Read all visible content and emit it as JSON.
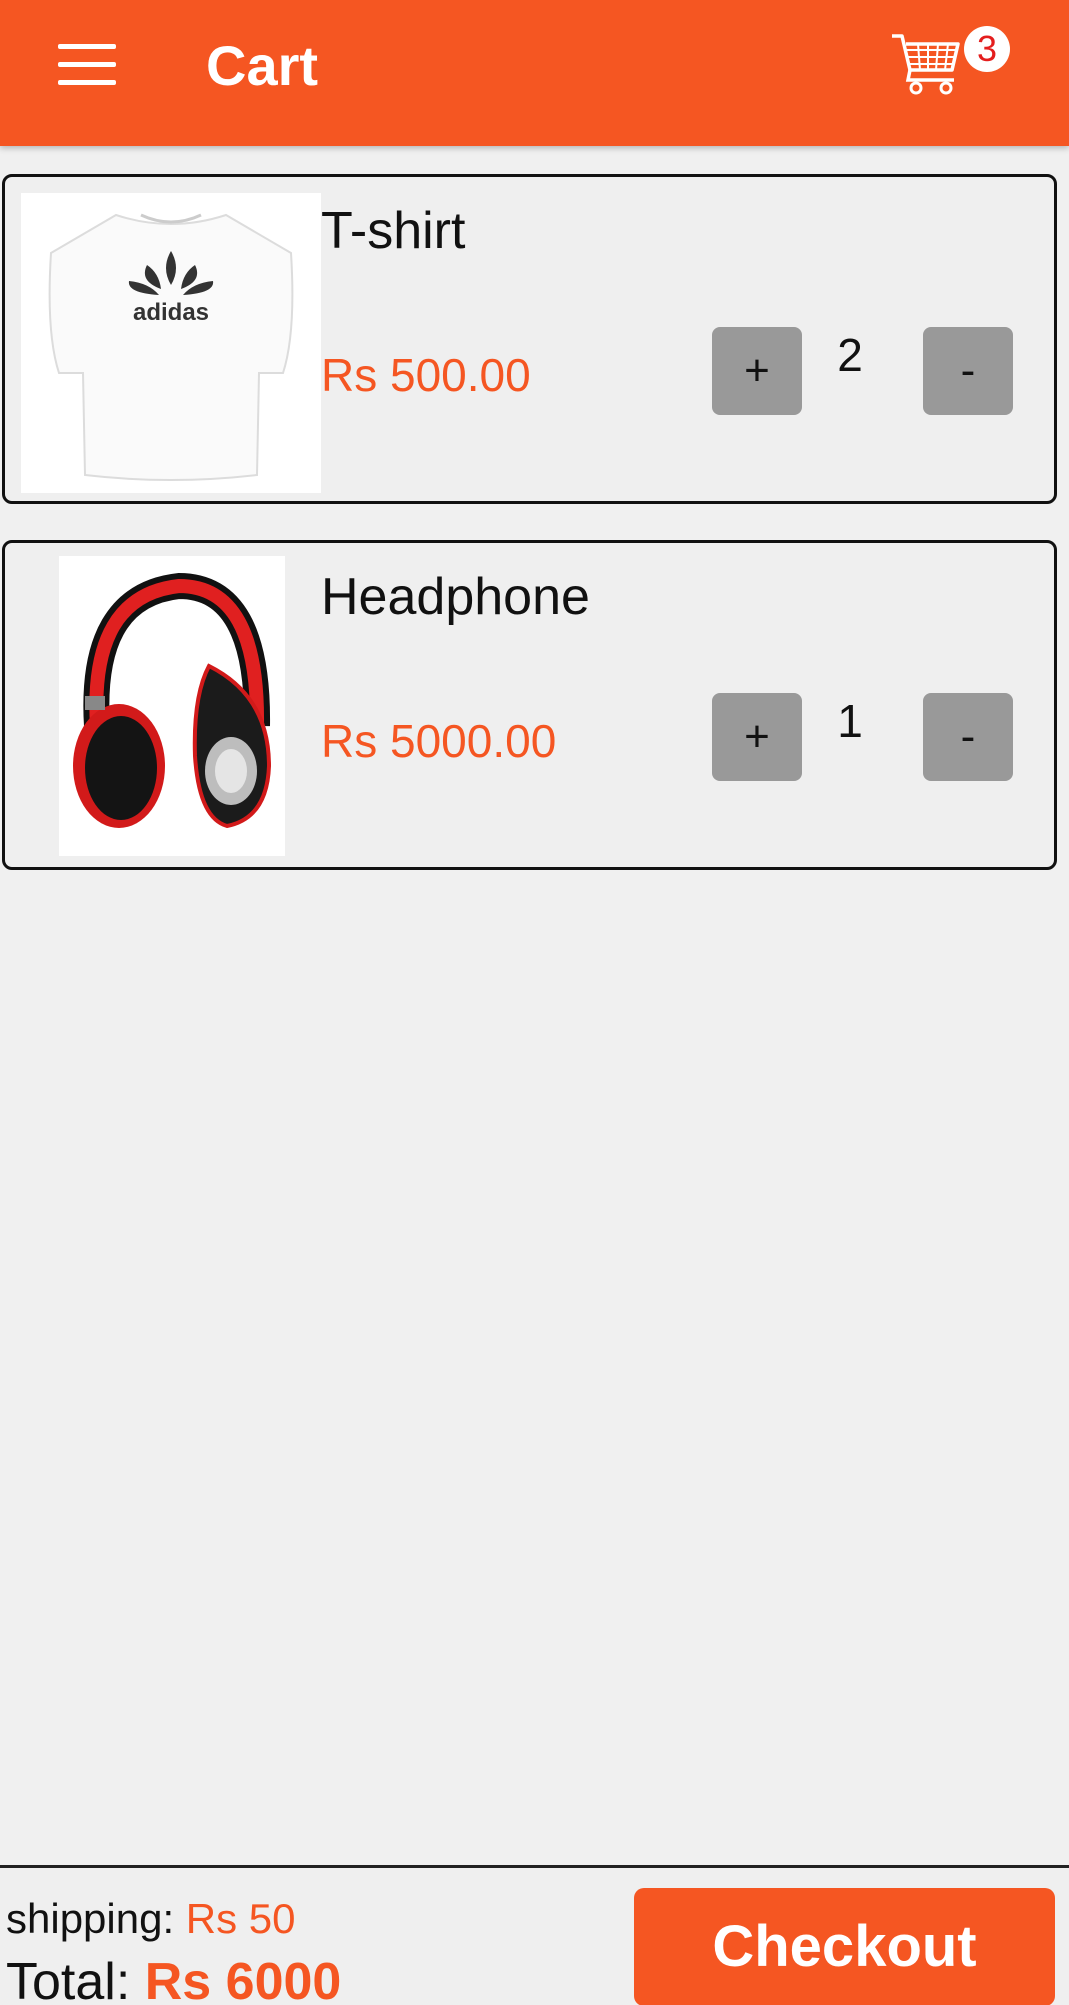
{
  "header": {
    "title": "Cart",
    "cart_count": "3"
  },
  "cart": {
    "items": [
      {
        "name": "T-shirt",
        "price": "Rs 500.00",
        "plus_label": "+",
        "quantity": "2",
        "minus_label": "-",
        "image_icon": "tshirt-image",
        "image_text": "adidas"
      },
      {
        "name": "Headphone",
        "price": "Rs 5000.00",
        "plus_label": "+",
        "quantity": "1",
        "minus_label": "-",
        "image_icon": "headphone-image"
      }
    ]
  },
  "footer": {
    "shipping_label": "shipping:",
    "shipping_value": "Rs 50",
    "total_label": "Total:",
    "total_value": "Rs 6000",
    "checkout_label": "Checkout"
  },
  "colors": {
    "accent": "#f55622",
    "background": "#f0f0f0",
    "button_gray": "#999999"
  }
}
